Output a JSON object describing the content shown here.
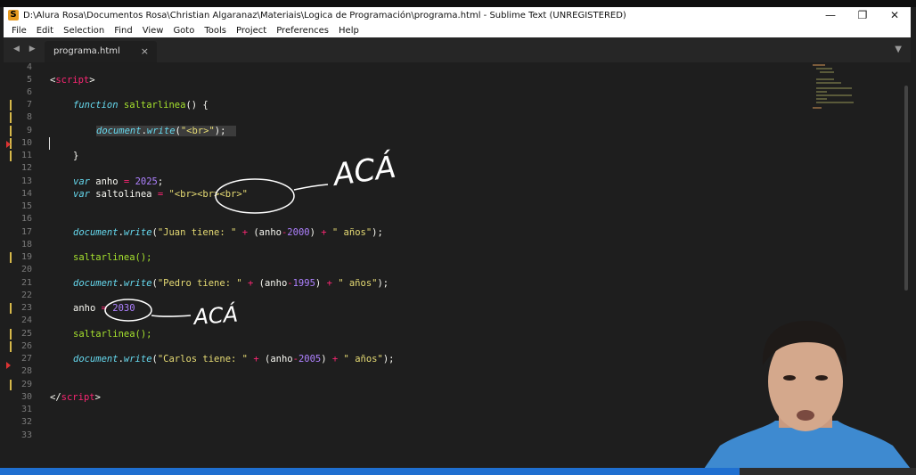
{
  "window": {
    "title": "D:\\Alura Rosa\\Documentos Rosa\\Christian Algaranaz\\Materiais\\Logica de Programación\\programa.html - Sublime Text (UNREGISTERED)",
    "app_icon_letter": "S",
    "controls": {
      "minimize": "—",
      "maximize": "❐",
      "close": "✕"
    }
  },
  "menu": [
    "File",
    "Edit",
    "Selection",
    "Find",
    "View",
    "Goto",
    "Tools",
    "Project",
    "Preferences",
    "Help"
  ],
  "tab": {
    "name": "programa.html",
    "close": "×",
    "nav": "◀ ▶",
    "dropdown": "▼"
  },
  "line_numbers": [
    "4",
    "5",
    "6",
    "7",
    "8",
    "9",
    "10",
    "11",
    "12",
    "13",
    "14",
    "15",
    "16",
    "17",
    "18",
    "19",
    "20",
    "21",
    "22",
    "23",
    "24",
    "25",
    "26",
    "27",
    "28",
    "29",
    "30",
    "31",
    "32",
    "33"
  ],
  "code": {
    "l5_open": "<",
    "l5_tag": "script",
    "l5_close": ">",
    "l7_kw": "function",
    "l7_fn": "saltarlinea",
    "l7_rest": "() {",
    "l9_obj": "document",
    "l9_dot": ".",
    "l9_fn": "write",
    "l9_open": "(",
    "l9_str": "\"<br>\"",
    "l9_close": ");",
    "l11_text": "}",
    "l13_kw": "var",
    "l13_name": " anho ",
    "l13_op": "=",
    "l13_num": "2025",
    "l13_end": ";",
    "l14_kw": "var",
    "l14_name": " saltolinea ",
    "l14_op": "=",
    "l14_str": "\"<br><br><br>\"",
    "l17_obj": "document",
    "l17_fn": "write",
    "l17_str1": "\"Juan tiene: \"",
    "l17_op1": "+",
    "l17_var": "anho",
    "l17_op2": "-",
    "l17_num": "2000",
    "l17_op3": "+",
    "l17_str2": "\" años\"",
    "l19_text": "saltarlinea();",
    "l21_obj": "document",
    "l21_fn": "write",
    "l21_str1": "\"Pedro tiene: \"",
    "l21_op1": "+",
    "l21_var": "anho",
    "l21_op2": "-",
    "l21_num": "1995",
    "l21_op3": "+",
    "l21_str2": "\" años\"",
    "l23_name": "anho ",
    "l23_op": "=",
    "l23_num": "2030",
    "l25_text": "saltarlinea();",
    "l27_obj": "document",
    "l27_fn": "write",
    "l27_str1": "\"Carlos tiene: \"",
    "l27_op1": "+",
    "l27_var": "anho",
    "l27_op2": "-",
    "l27_num": "2005",
    "l27_op3": "+",
    "l27_str2": "\" años\"",
    "l30_open": "</",
    "l30_tag": "script",
    "l30_close": ">"
  },
  "handwriting": {
    "note_top": "ACÁ",
    "note_bottom": "ACÁ"
  },
  "colors": {
    "editor_bg": "#1e1e1e",
    "tag": "#f92672",
    "keyword": "#66d9ef",
    "function": "#a6e22e",
    "string": "#e6db74",
    "number": "#ae81ff",
    "app_icon": "#e69b21",
    "taskbar": "#1f6fd0"
  }
}
